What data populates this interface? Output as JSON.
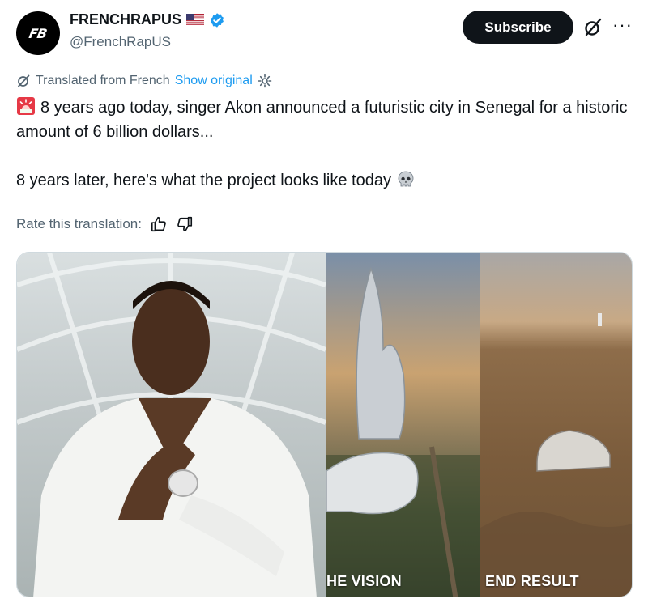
{
  "author": {
    "display_name": "FRENCHRAPUS",
    "handle": "@FrenchRapUS",
    "avatar_text": "FB",
    "verified_color": "#1d9bf0"
  },
  "actions": {
    "subscribe_label": "Subscribe",
    "more_label": "···"
  },
  "translation": {
    "label": "Translated from French",
    "show_original": "Show original",
    "rate_label": "Rate this translation:"
  },
  "tweet": {
    "line1": "8 years ago today, singer Akon announced a futuristic city in Senegal for a historic amount of 6 billion dollars...",
    "line2": "8 years later, here's what the project looks like today",
    "emoji_start": "siren-icon",
    "emoji_end": "skull-icon"
  },
  "media": {
    "caption_vision": "HE VISION",
    "caption_result": "END RESULT"
  },
  "colors": {
    "text": "#0f1419",
    "muted": "#536471",
    "link": "#1d9bf0",
    "button_bg": "#0f1419"
  }
}
